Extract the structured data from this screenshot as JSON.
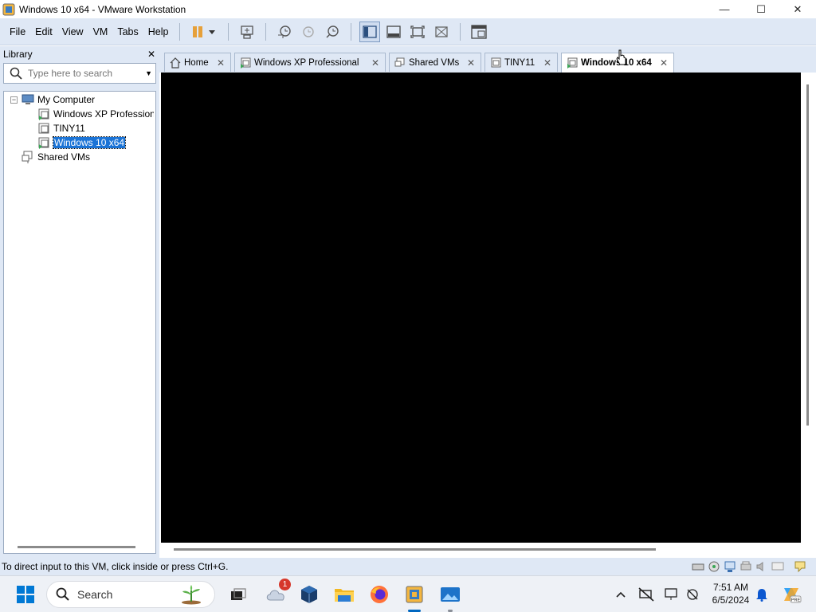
{
  "window": {
    "title": "Windows 10 x64 - VMware Workstation",
    "controls": {
      "minimize": "—",
      "maximize": "☐",
      "close": "✕"
    }
  },
  "menu": [
    "File",
    "Edit",
    "View",
    "VM",
    "Tabs",
    "Help"
  ],
  "toolbar": {
    "icons": [
      "pause-icon",
      "send-keys-icon",
      "snapshot-take-icon",
      "snapshot-revert-icon",
      "snapshot-manager-icon",
      "library-view-icon",
      "thumbnail-bar-icon",
      "full-screen-icon",
      "unity-icon",
      "console-view-icon"
    ]
  },
  "library": {
    "title": "Library",
    "close": "✕",
    "search_placeholder": "Type here to search",
    "tree": [
      {
        "label": "My Computer",
        "icon": "computer-icon"
      },
      {
        "label": "Windows XP Professional",
        "icon": "vm-running-icon"
      },
      {
        "label": "TINY11",
        "icon": "vm-icon"
      },
      {
        "label": "Windows 10 x64",
        "icon": "vm-running-icon",
        "selected": true
      },
      {
        "label": "Shared VMs",
        "icon": "shared-vms-icon"
      }
    ]
  },
  "tabs": [
    {
      "label": "Home",
      "close": "✕"
    },
    {
      "label": "Windows XP Professional",
      "close": "✕"
    },
    {
      "label": "Shared VMs",
      "close": "✕"
    },
    {
      "label": "TINY11",
      "close": "✕"
    },
    {
      "label": "Windows 10 x64",
      "close": "✕",
      "active": true
    }
  ],
  "status": {
    "message": "To direct input to this VM, click inside or press Ctrl+G."
  },
  "taskbar": {
    "search_label": "Search",
    "notification_count": "1",
    "clock_time": "7:51 AM",
    "clock_date": "6/5/2024"
  },
  "colors": {
    "chrome": "#dfe8f5",
    "console": "#000000",
    "selection": "#1a73d6",
    "taskbar": "#eef1f6"
  }
}
